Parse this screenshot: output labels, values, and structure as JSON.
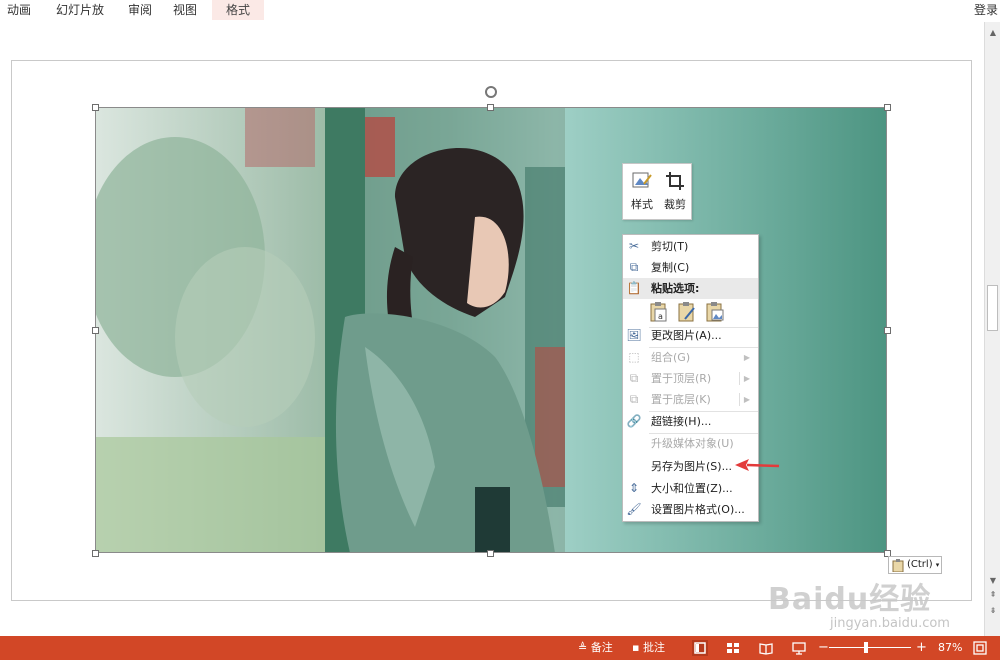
{
  "ribbon": {
    "tabs": [
      {
        "label": "动画"
      },
      {
        "label": "幻灯片放映"
      },
      {
        "label": "审阅"
      },
      {
        "label": "视图"
      },
      {
        "label": "格式"
      }
    ],
    "login": "登录"
  },
  "mini_toolbar": {
    "style_label": "样式",
    "crop_label": "裁剪"
  },
  "context_menu": {
    "items": [
      {
        "label": "剪切(T)",
        "icon": "scissors-icon",
        "enabled": true
      },
      {
        "label": "复制(C)",
        "icon": "copy-icon",
        "enabled": true
      },
      {
        "label": "粘贴选项:",
        "icon": "paste-icon",
        "enabled": true
      },
      {
        "label": "更改图片(A)...",
        "icon": "change-picture-icon",
        "enabled": true
      },
      {
        "label": "组合(G)",
        "icon": "group-icon",
        "enabled": false
      },
      {
        "label": "置于顶层(R)",
        "icon": "bring-to-front-icon",
        "enabled": false
      },
      {
        "label": "置于底层(K)",
        "icon": "send-to-back-icon",
        "enabled": false
      },
      {
        "label": "超链接(H)...",
        "icon": "hyperlink-icon",
        "enabled": true
      },
      {
        "label": "升级媒体对象(U)",
        "icon": "",
        "enabled": false
      },
      {
        "label": "另存为图片(S)...",
        "icon": "",
        "enabled": true
      },
      {
        "label": "大小和位置(Z)...",
        "icon": "size-position-icon",
        "enabled": true
      },
      {
        "label": "设置图片格式(O)...",
        "icon": "format-picture-icon",
        "enabled": true
      }
    ]
  },
  "paste_tag": {
    "label": "(Ctrl)"
  },
  "status_bar": {
    "notes_label": "备注",
    "comments_label": "批注",
    "zoom_minus": "−",
    "zoom_plus": "+",
    "zoom_level": "87%"
  },
  "watermark": {
    "brand": "Baidu经验",
    "url": "jingyan.baidu.com"
  },
  "colors": {
    "status_bar": "#d24726",
    "active_tab_bg": "#fbe9e6",
    "arrow": "#e33b3b"
  }
}
